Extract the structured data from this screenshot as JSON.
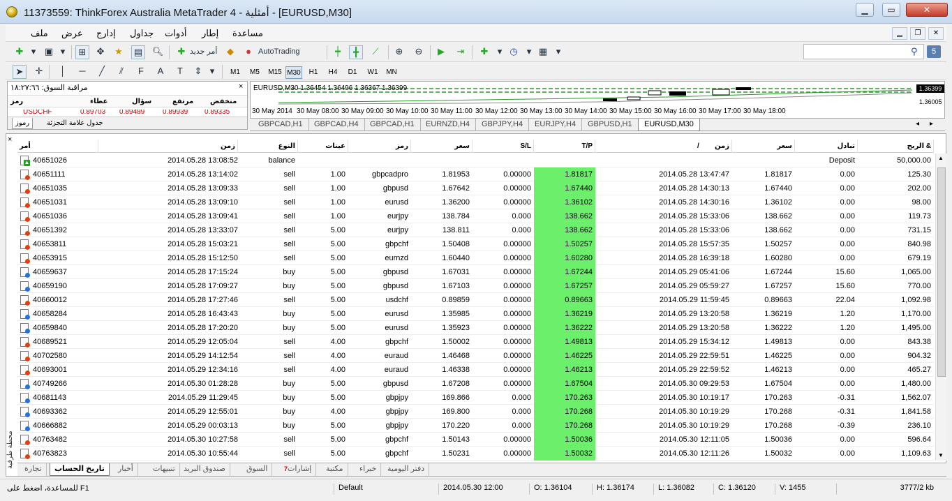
{
  "window": {
    "title": "11373559: ThinkForex Australia MetaTrader 4 - أمثلية - [EURUSD,M30]",
    "min": "▁",
    "max": "▭",
    "close": "✕"
  },
  "menu": [
    "ملف",
    "عرض",
    "إدارج",
    "جداول",
    "أدوات",
    "إطار",
    "مساعدة"
  ],
  "toolbar": {
    "new_order": "أمر جديد",
    "autotrading": "AutoTrading",
    "help_badge": "5"
  },
  "timeframes": [
    "M1",
    "M5",
    "M15",
    "M30",
    "H1",
    "H4",
    "D1",
    "W1",
    "MN"
  ],
  "active_timeframe": "M30",
  "market_watch": {
    "title": "مراقبة السوق: ١٨:٢٧:٦٦",
    "close": "×",
    "headers": {
      "symbol": "رمز",
      "bid": "عطاء",
      "ask": "سؤال",
      "high": "مرتفع",
      "low": "منخفض"
    },
    "row": {
      "symbol": "USDCHF",
      "bid": "0.89703",
      "ask": "0.89489",
      "high": "0.89939",
      "low": "0.89335"
    },
    "tabs": [
      "رموز",
      "جدول علامة التجزئة"
    ]
  },
  "chart": {
    "header": "EURUSD,M30  1.36454 1.36496 1.36367 1.36399",
    "price_current": "1.36399",
    "price_low": "1.36005",
    "time_labels": [
      "30 May 2014",
      "30 May 08:00",
      "30 May 09:00",
      "30 May 10:00",
      "30 May 11:00",
      "30 May 12:00",
      "30 May 13:00",
      "30 May 14:00",
      "30 May 15:00",
      "30 May 16:00",
      "30 May 17:00",
      "30 May 18:00"
    ],
    "tabs": [
      "GBPCAD,H1",
      "GBPCAD,H4",
      "GBPCAD,H1",
      "EURNZD,H4",
      "GBPJPY,H4",
      "EURJPY,H4",
      "GBPUSD,H1",
      "EURUSD,M30"
    ],
    "active_tab": "EURUSD,M30"
  },
  "terminal": {
    "close": "×",
    "vertical_label": "محطة طرفية",
    "headers": {
      "order": "أمر",
      "open_time": "زمن",
      "type": "النوع",
      "lots": "عينات",
      "symbol": "رمز",
      "open_price": "سعر",
      "sl": "S/L",
      "tp": "T/P",
      "close_time": "زمن",
      "close_price": "سعر",
      "swap": "تبادل",
      "profit": "الربح &"
    },
    "sort_mark": "/",
    "rows": [
      {
        "kind": "dep",
        "order": "40651026",
        "open_time": "2014.05.28 13:08:52",
        "type": "balance",
        "lots": "",
        "symbol": "",
        "open_price": "",
        "sl": "",
        "tp": "",
        "close_time": "",
        "close_price": "",
        "swap": "Deposit",
        "profit": "50,000.00"
      },
      {
        "kind": "sell",
        "order": "40651111",
        "open_time": "2014.05.28 13:14:02",
        "type": "sell",
        "lots": "1.00",
        "symbol": "gbpcadpro",
        "open_price": "1.81953",
        "sl": "0.00000",
        "tp": "1.81817",
        "close_time": "2014.05.28 13:47:47",
        "close_price": "1.81817",
        "swap": "0.00",
        "profit": "125.30"
      },
      {
        "kind": "sell",
        "order": "40651035",
        "open_time": "2014.05.28 13:09:33",
        "type": "sell",
        "lots": "1.00",
        "symbol": "gbpusd",
        "open_price": "1.67642",
        "sl": "0.00000",
        "tp": "1.67440",
        "close_time": "2014.05.28 14:30:13",
        "close_price": "1.67440",
        "swap": "0.00",
        "profit": "202.00"
      },
      {
        "kind": "sell",
        "order": "40651031",
        "open_time": "2014.05.28 13:09:10",
        "type": "sell",
        "lots": "1.00",
        "symbol": "eurusd",
        "open_price": "1.36200",
        "sl": "0.00000",
        "tp": "1.36102",
        "close_time": "2014.05.28 14:30:16",
        "close_price": "1.36102",
        "swap": "0.00",
        "profit": "98.00"
      },
      {
        "kind": "sell",
        "order": "40651036",
        "open_time": "2014.05.28 13:09:41",
        "type": "sell",
        "lots": "1.00",
        "symbol": "eurjpy",
        "open_price": "138.784",
        "sl": "0.000",
        "tp": "138.662",
        "close_time": "2014.05.28 15:33:06",
        "close_price": "138.662",
        "swap": "0.00",
        "profit": "119.73"
      },
      {
        "kind": "sell",
        "order": "40651392",
        "open_time": "2014.05.28 13:33:07",
        "type": "sell",
        "lots": "5.00",
        "symbol": "eurjpy",
        "open_price": "138.811",
        "sl": "0.000",
        "tp": "138.662",
        "close_time": "2014.05.28 15:33:06",
        "close_price": "138.662",
        "swap": "0.00",
        "profit": "731.15"
      },
      {
        "kind": "sell",
        "order": "40653811",
        "open_time": "2014.05.28 15:03:21",
        "type": "sell",
        "lots": "5.00",
        "symbol": "gbpchf",
        "open_price": "1.50408",
        "sl": "0.00000",
        "tp": "1.50257",
        "close_time": "2014.05.28 15:57:35",
        "close_price": "1.50257",
        "swap": "0.00",
        "profit": "840.98"
      },
      {
        "kind": "sell",
        "order": "40653915",
        "open_time": "2014.05.28 15:12:50",
        "type": "sell",
        "lots": "5.00",
        "symbol": "eurnzd",
        "open_price": "1.60440",
        "sl": "0.00000",
        "tp": "1.60280",
        "close_time": "2014.05.28 16:39:18",
        "close_price": "1.60280",
        "swap": "0.00",
        "profit": "679.19"
      },
      {
        "kind": "buy",
        "order": "40659637",
        "open_time": "2014.05.28 17:15:24",
        "type": "buy",
        "lots": "5.00",
        "symbol": "gbpusd",
        "open_price": "1.67031",
        "sl": "0.00000",
        "tp": "1.67244",
        "close_time": "2014.05.29 05:41:06",
        "close_price": "1.67244",
        "swap": "15.60",
        "profit": "1,065.00"
      },
      {
        "kind": "buy",
        "order": "40659190",
        "open_time": "2014.05.28 17:09:27",
        "type": "buy",
        "lots": "5.00",
        "symbol": "gbpusd",
        "open_price": "1.67103",
        "sl": "0.00000",
        "tp": "1.67257",
        "close_time": "2014.05.29 05:59:27",
        "close_price": "1.67257",
        "swap": "15.60",
        "profit": "770.00"
      },
      {
        "kind": "sell",
        "order": "40660012",
        "open_time": "2014.05.28 17:27:46",
        "type": "sell",
        "lots": "5.00",
        "symbol": "usdchf",
        "open_price": "0.89859",
        "sl": "0.00000",
        "tp": "0.89663",
        "close_time": "2014.05.29 11:59:45",
        "close_price": "0.89663",
        "swap": "22.04",
        "profit": "1,092.98"
      },
      {
        "kind": "buy",
        "order": "40658284",
        "open_time": "2014.05.28 16:43:43",
        "type": "buy",
        "lots": "5.00",
        "symbol": "eurusd",
        "open_price": "1.35985",
        "sl": "0.00000",
        "tp": "1.36219",
        "close_time": "2014.05.29 13:20:58",
        "close_price": "1.36219",
        "swap": "1.20",
        "profit": "1,170.00"
      },
      {
        "kind": "buy",
        "order": "40659840",
        "open_time": "2014.05.28 17:20:20",
        "type": "buy",
        "lots": "5.00",
        "symbol": "eurusd",
        "open_price": "1.35923",
        "sl": "0.00000",
        "tp": "1.36222",
        "close_time": "2014.05.29 13:20:58",
        "close_price": "1.36222",
        "swap": "1.20",
        "profit": "1,495.00"
      },
      {
        "kind": "sell",
        "order": "40689521",
        "open_time": "2014.05.29 12:05:04",
        "type": "sell",
        "lots": "4.00",
        "symbol": "gbpchf",
        "open_price": "1.50002",
        "sl": "0.00000",
        "tp": "1.49813",
        "close_time": "2014.05.29 15:34:12",
        "close_price": "1.49813",
        "swap": "0.00",
        "profit": "843.38"
      },
      {
        "kind": "sell",
        "order": "40702580",
        "open_time": "2014.05.29 14:12:54",
        "type": "sell",
        "lots": "4.00",
        "symbol": "euraud",
        "open_price": "1.46468",
        "sl": "0.00000",
        "tp": "1.46225",
        "close_time": "2014.05.29 22:59:51",
        "close_price": "1.46225",
        "swap": "0.00",
        "profit": "904.32"
      },
      {
        "kind": "sell",
        "order": "40693001",
        "open_time": "2014.05.29 12:34:16",
        "type": "sell",
        "lots": "4.00",
        "symbol": "euraud",
        "open_price": "1.46338",
        "sl": "0.00000",
        "tp": "1.46213",
        "close_time": "2014.05.29 22:59:52",
        "close_price": "1.46213",
        "swap": "0.00",
        "profit": "465.27"
      },
      {
        "kind": "buy",
        "order": "40749266",
        "open_time": "2014.05.30 01:28:28",
        "type": "buy",
        "lots": "5.00",
        "symbol": "gbpusd",
        "open_price": "1.67208",
        "sl": "0.00000",
        "tp": "1.67504",
        "close_time": "2014.05.30 09:29:53",
        "close_price": "1.67504",
        "swap": "0.00",
        "profit": "1,480.00"
      },
      {
        "kind": "buy",
        "order": "40681143",
        "open_time": "2014.05.29 11:29:45",
        "type": "buy",
        "lots": "5.00",
        "symbol": "gbpjpy",
        "open_price": "169.866",
        "sl": "0.000",
        "tp": "170.263",
        "close_time": "2014.05.30 10:19:17",
        "close_price": "170.263",
        "swap": "-0.31",
        "profit": "1,562.07"
      },
      {
        "kind": "buy",
        "order": "40693362",
        "open_time": "2014.05.29 12:55:01",
        "type": "buy",
        "lots": "4.00",
        "symbol": "gbpjpy",
        "open_price": "169.800",
        "sl": "0.000",
        "tp": "170.268",
        "close_time": "2014.05.30 10:19:29",
        "close_price": "170.268",
        "swap": "-0.31",
        "profit": "1,841.58"
      },
      {
        "kind": "buy",
        "order": "40666882",
        "open_time": "2014.05.29 00:03:13",
        "type": "buy",
        "lots": "5.00",
        "symbol": "gbpjpy",
        "open_price": "170.220",
        "sl": "0.000",
        "tp": "170.268",
        "close_time": "2014.05.30 10:19:29",
        "close_price": "170.268",
        "swap": "-0.39",
        "profit": "236.10"
      },
      {
        "kind": "sell",
        "order": "40763482",
        "open_time": "2014.05.30 10:27:58",
        "type": "sell",
        "lots": "5.00",
        "symbol": "gbpchf",
        "open_price": "1.50143",
        "sl": "0.00000",
        "tp": "1.50036",
        "close_time": "2014.05.30 12:11:05",
        "close_price": "1.50036",
        "swap": "0.00",
        "profit": "596.64"
      },
      {
        "kind": "sell",
        "order": "40763823",
        "open_time": "2014.05.30 10:55:44",
        "type": "sell",
        "lots": "5.00",
        "symbol": "gbpchf",
        "open_price": "1.50231",
        "sl": "0.00000",
        "tp": "1.50032",
        "close_time": "2014.05.30 12:11:26",
        "close_price": "1.50032",
        "swap": "0.00",
        "profit": "1,109.63"
      }
    ],
    "tabs": [
      {
        "label": "تجارة",
        "badge": ""
      },
      {
        "label": "تاريخ الحساب",
        "badge": ""
      },
      {
        "label": "أخبار",
        "badge": ""
      },
      {
        "label": "تنبيهات",
        "badge": ""
      },
      {
        "label": "صندوق البريد",
        "badge": ""
      },
      {
        "label": "السوق",
        "badge": ""
      },
      {
        "label": "إشارات",
        "badge": "7"
      },
      {
        "label": "مكتبة",
        "badge": ""
      },
      {
        "label": "خبراء",
        "badge": ""
      },
      {
        "label": "دفتر اليومية",
        "badge": ""
      }
    ],
    "active_tab": 1
  },
  "status": {
    "help": "للمساعدة، اضغط على F1",
    "profile": "Default",
    "datetime": "2014.05.30 12:00",
    "open": "O: 1.36104",
    "high": "H: 1.36174",
    "low": "L: 1.36082",
    "close": "C: 1.36120",
    "volume": "V: 1455",
    "traffic": "3777/2 kb"
  },
  "colors": {
    "tp_highlight": "#6cf06c",
    "sell_icon": "#e04010",
    "buy_icon": "#2070e0"
  }
}
